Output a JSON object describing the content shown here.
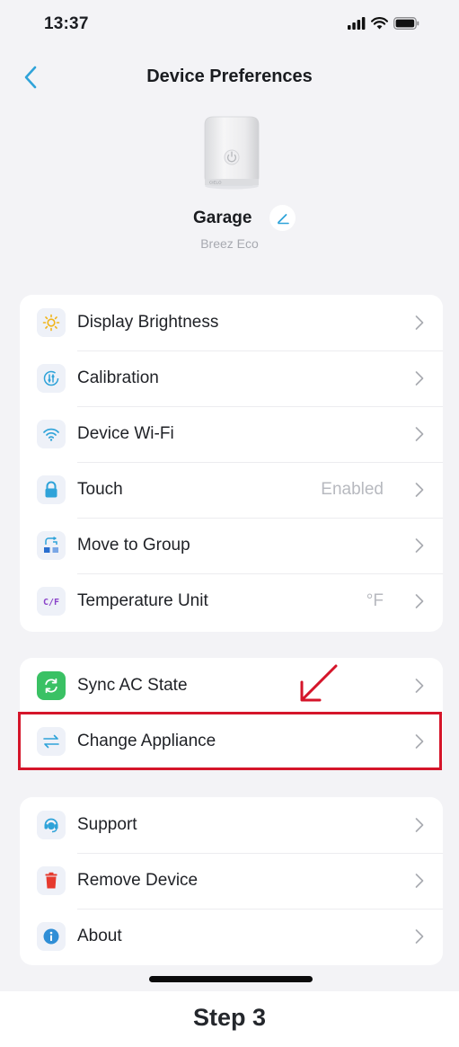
{
  "status_bar": {
    "time": "13:37",
    "icons": [
      "signal-icon",
      "wifi-icon",
      "battery-icon"
    ]
  },
  "nav": {
    "title": "Device Preferences",
    "back_icon": "chevron-left-icon"
  },
  "device": {
    "name": "Garage",
    "model": "Breez Eco",
    "brand_mark": "CIELO"
  },
  "settings": [
    {
      "label": "Display Brightness",
      "value": "",
      "icon": "sun-icon"
    },
    {
      "label": "Calibration",
      "value": "",
      "icon": "calibration-icon"
    },
    {
      "label": "Device Wi-Fi",
      "value": "",
      "icon": "wifi-icon"
    },
    {
      "label": "Touch",
      "value": "Enabled",
      "icon": "lock-icon"
    },
    {
      "label": "Move to Group",
      "value": "",
      "icon": "group-icon"
    },
    {
      "label": "Temperature Unit",
      "value": "°F",
      "icon": "temperature-unit-icon"
    }
  ],
  "appliance": [
    {
      "label": "Sync AC State",
      "value": "",
      "icon": "sync-icon"
    },
    {
      "label": "Change Appliance",
      "value": "",
      "icon": "swap-icon"
    }
  ],
  "support": [
    {
      "label": "Support",
      "value": "",
      "icon": "support-icon"
    },
    {
      "label": "Remove Device",
      "value": "",
      "icon": "trash-icon"
    },
    {
      "label": "About",
      "value": "",
      "icon": "info-icon"
    }
  ],
  "annotation": {
    "step_label": "Step 3"
  },
  "colors": {
    "accent": "#2fa3d9",
    "highlight": "#d5152a",
    "sync_green": "#3ac164",
    "danger": "#e63a2e",
    "background": "#f3f3f6"
  }
}
